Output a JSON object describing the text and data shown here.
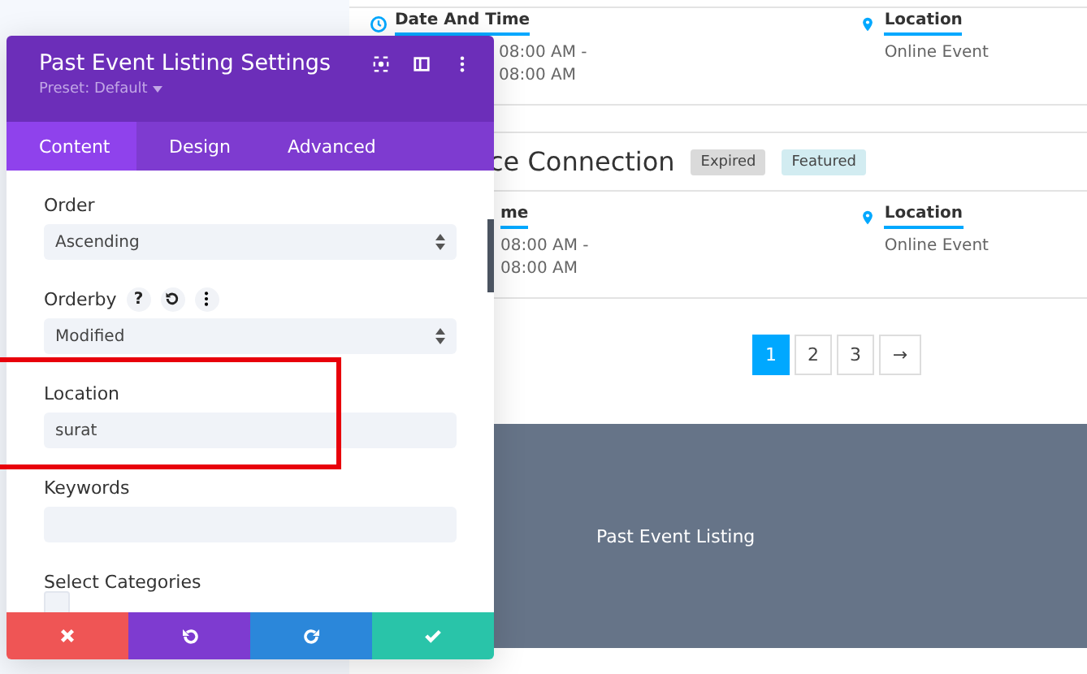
{
  "events": [
    {
      "time_label": "Date And Time",
      "times": [
        "08:00 AM -",
        "08:00 AM"
      ],
      "location_label": "Location",
      "location": "Online Event"
    },
    {
      "heading": {
        "title": "ce Connection",
        "badges": [
          {
            "label": "Expired",
            "kind": "expired"
          },
          {
            "label": "Featured",
            "kind": "featured"
          }
        ]
      },
      "time_label": "me",
      "times": [
        "08:00 AM -",
        "08:00 AM"
      ],
      "location_label": "Location",
      "location": "Online Event"
    }
  ],
  "pagination": [
    {
      "label": "1",
      "selected": true
    },
    {
      "label": "2",
      "selected": false
    },
    {
      "label": "3",
      "selected": false
    },
    {
      "label": "→",
      "selected": false
    }
  ],
  "footer": {
    "title": "Past Event Listing"
  },
  "panel": {
    "title": "Past Event Listing Settings",
    "preset": "Preset: Default",
    "tabs": [
      {
        "label": "Content",
        "selected": true
      },
      {
        "label": "Design",
        "selected": false
      },
      {
        "label": "Advanced",
        "selected": false
      }
    ],
    "fields": [
      {
        "kind": "select",
        "label": "Order",
        "value": "Ascending"
      },
      {
        "kind": "select",
        "label": "Orderby",
        "value": "Modified",
        "tools": [
          "?"
        ]
      },
      {
        "kind": "input",
        "label": "Location",
        "value": "surat",
        "highlighted": true
      },
      {
        "kind": "input",
        "label": "Keywords"
      },
      {
        "kind": "checkboxes",
        "label": "Select Categories",
        "checked": false
      }
    ]
  }
}
